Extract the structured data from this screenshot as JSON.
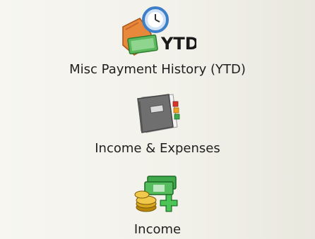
{
  "nav": {
    "items": [
      {
        "label": "Misc Payment History (YTD)",
        "icon": "payment-history-ytd-icon",
        "icon_text": "YTD"
      },
      {
        "label": "Income & Expenses",
        "icon": "ledger-book-icon"
      },
      {
        "label": "Income",
        "icon": "money-add-icon"
      }
    ]
  },
  "colors": {
    "background": "#f2f1ea",
    "label_text": "#1f1f1f",
    "clock_blue": "#3f7fc9",
    "hand_orange": "#e8883a",
    "book_gray": "#6f6f6f",
    "money_green": "#3ea84a",
    "coin_gold": "#d9a820"
  }
}
